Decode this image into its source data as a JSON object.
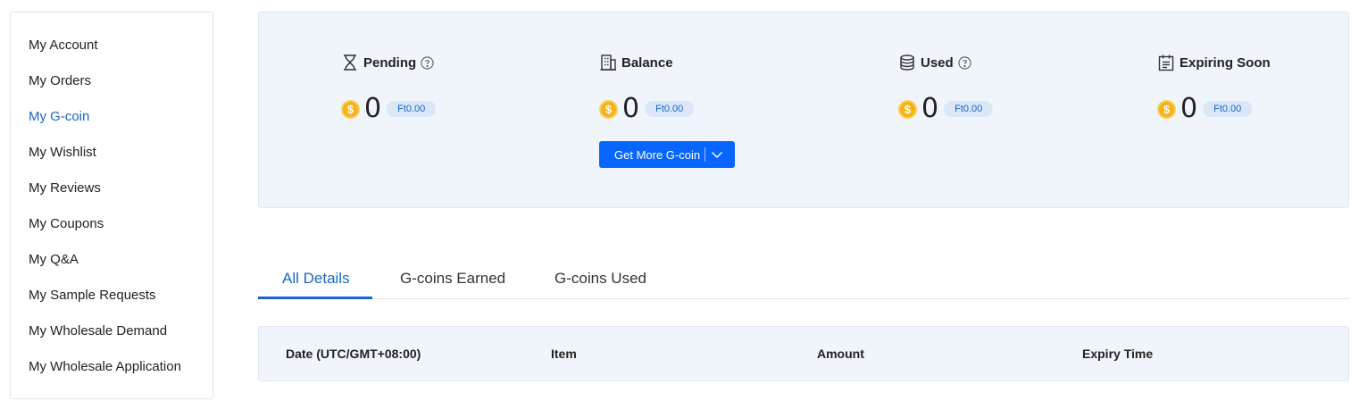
{
  "sidebar": {
    "items": [
      {
        "label": "My Account"
      },
      {
        "label": "My Orders"
      },
      {
        "label": "My G-coin",
        "active": true
      },
      {
        "label": "My Wishlist"
      },
      {
        "label": "My Reviews"
      },
      {
        "label": "My Coupons"
      },
      {
        "label": "My Q&A"
      },
      {
        "label": "My Sample Requests"
      },
      {
        "label": "My Wholesale Demand"
      },
      {
        "label": "My Wholesale Application"
      }
    ]
  },
  "summary": {
    "stats": [
      {
        "label": "Pending",
        "icon": "hourglass-icon",
        "has_help": true,
        "coins": "0",
        "value": "Ft0.00"
      },
      {
        "label": "Balance",
        "icon": "building-icon",
        "has_help": false,
        "coins": "0",
        "value": "Ft0.00"
      },
      {
        "label": "Used",
        "icon": "database-icon",
        "has_help": true,
        "coins": "0",
        "value": "Ft0.00"
      },
      {
        "label": "Expiring Soon",
        "icon": "calendar-icon",
        "has_help": false,
        "coins": "0",
        "value": "Ft0.00"
      }
    ],
    "coin_symbol": "$",
    "get_more_label": "Get More G-coin"
  },
  "tabs": [
    {
      "label": "All Details",
      "active": true
    },
    {
      "label": "G-coins Earned"
    },
    {
      "label": "G-coins Used"
    }
  ],
  "table": {
    "columns": [
      "Date (UTC/GMT+08:00)",
      "Item",
      "Amount",
      "Expiry Time"
    ]
  },
  "colors": {
    "accent": "#1a66c8",
    "button": "#0866ff",
    "panel_bg": "#f0f5fc",
    "coin": "#f5b21b"
  }
}
